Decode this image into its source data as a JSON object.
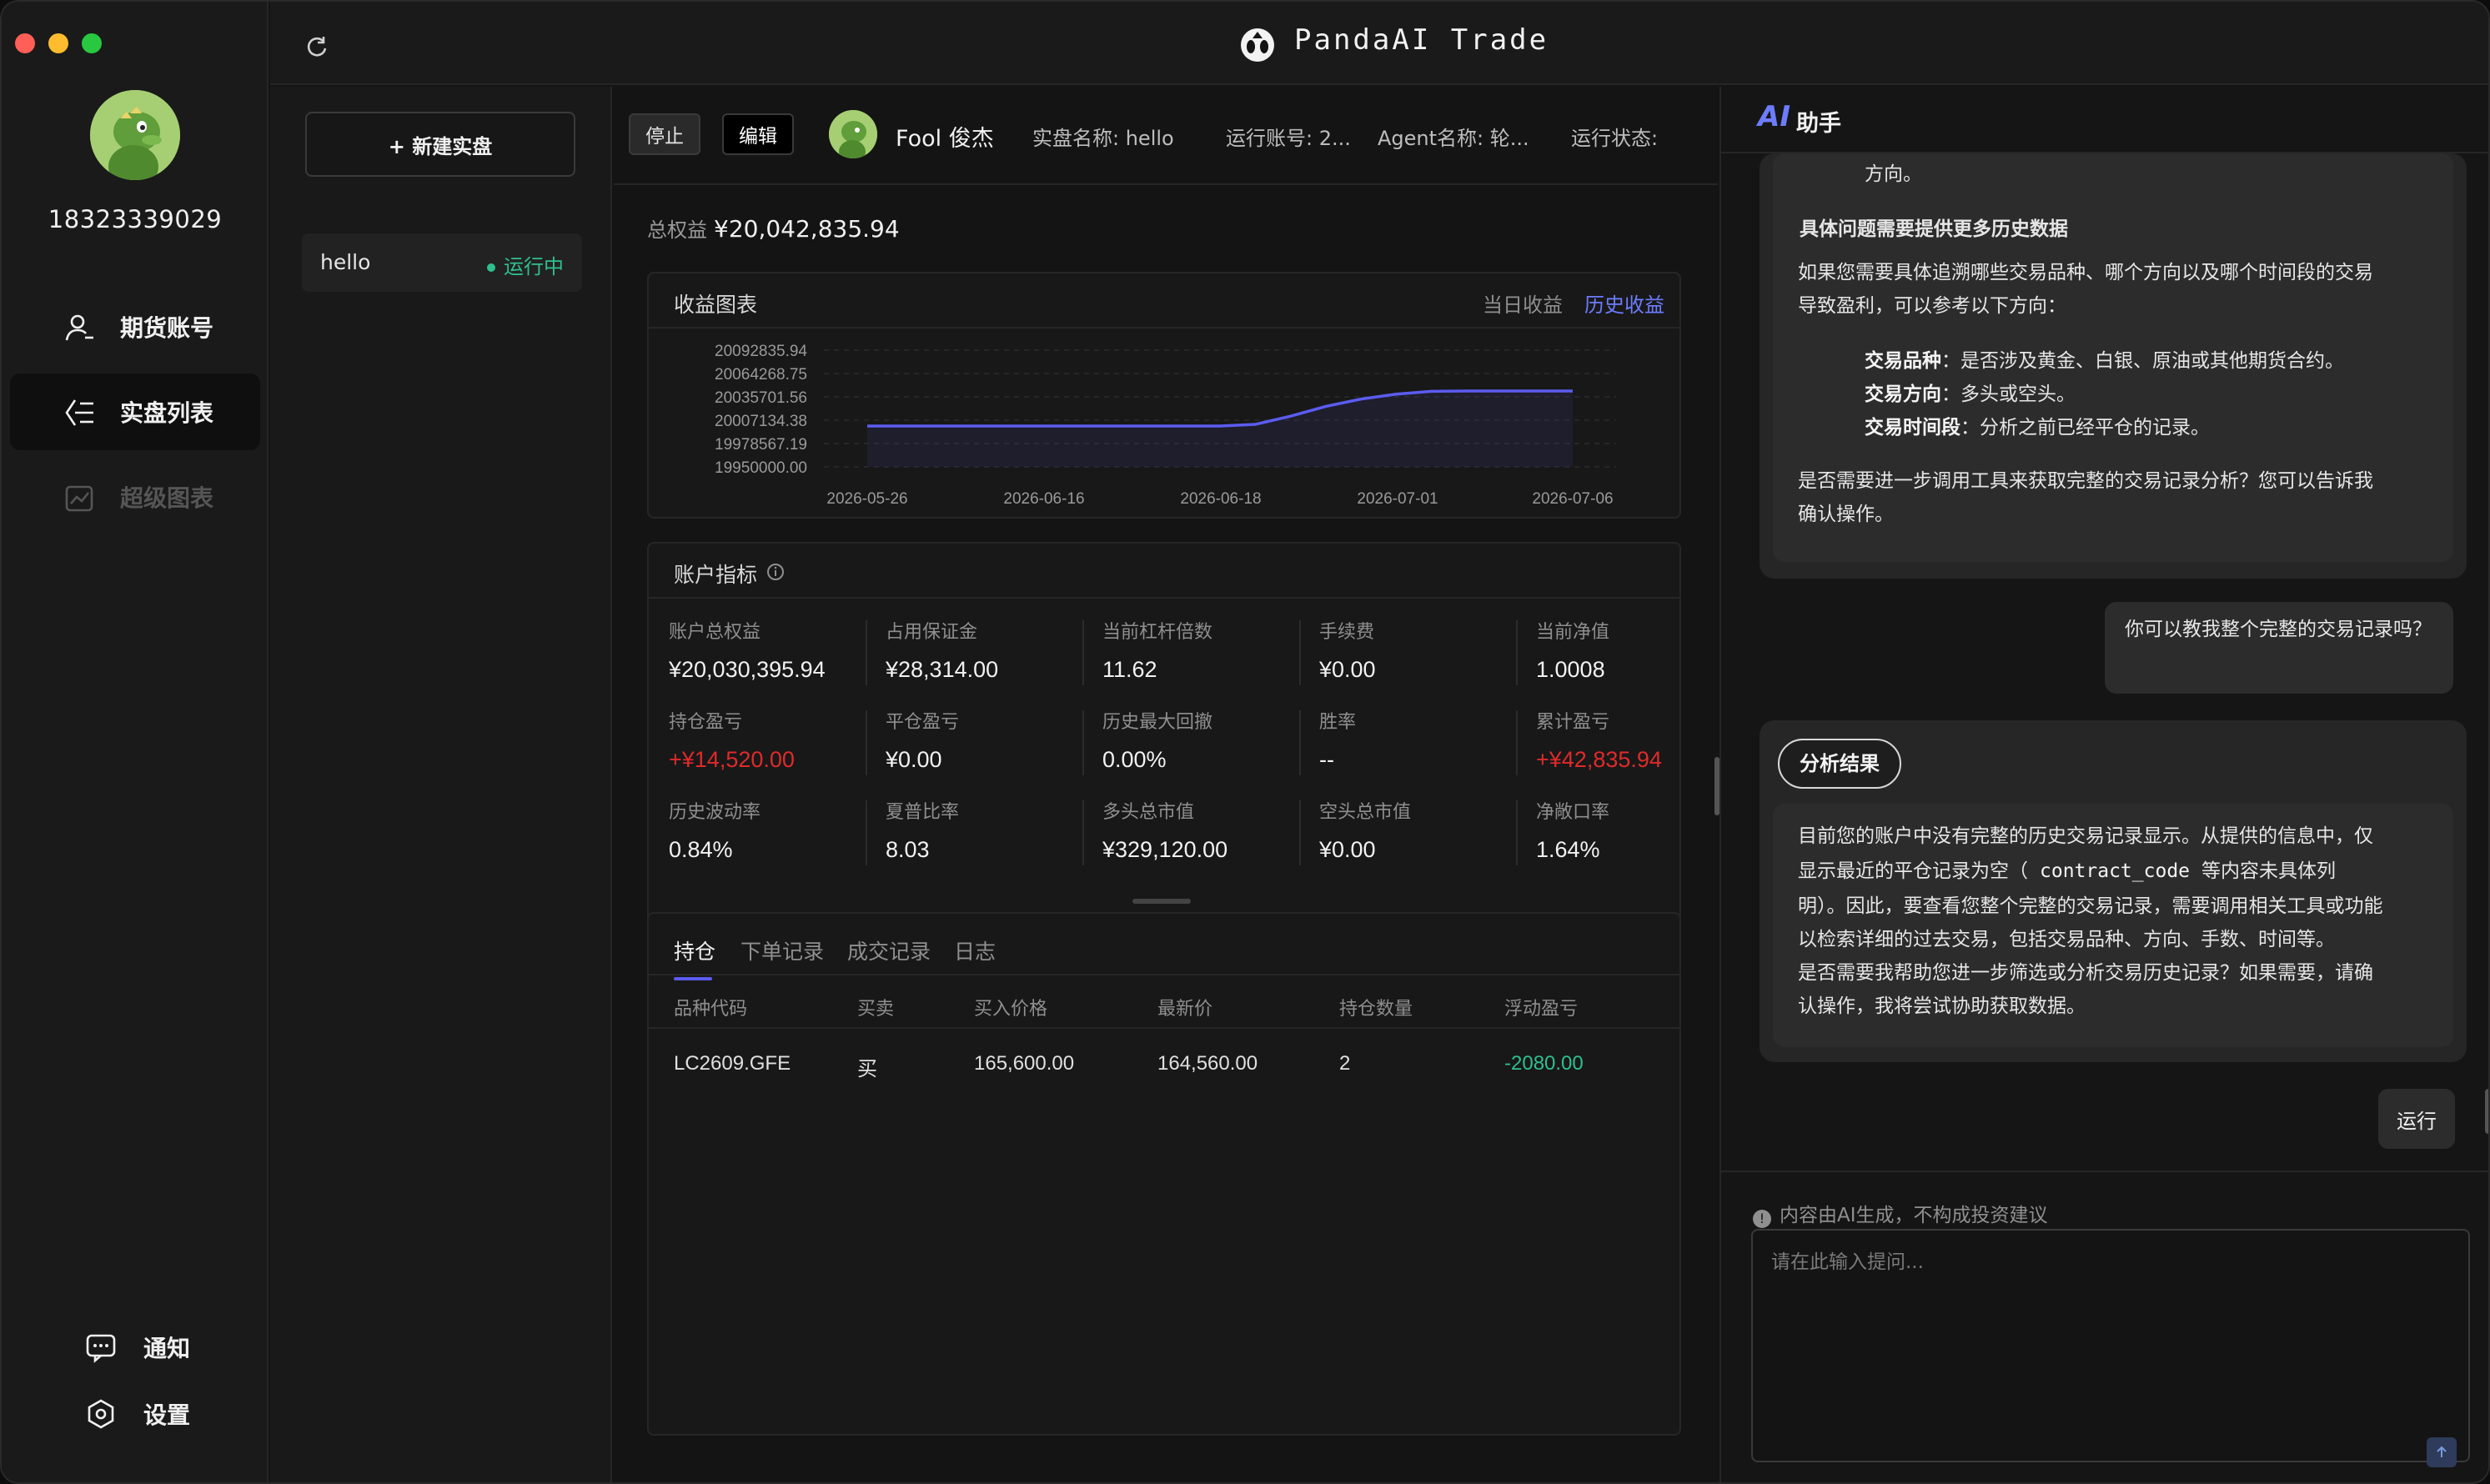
{
  "app": {
    "title": "PandaAI Trade"
  },
  "colors": {
    "accent": "#5b5cf0",
    "up": "#e02a2a",
    "down": "#2fbf8f",
    "background": "#141414"
  },
  "sidebar": {
    "phone": "18323339029",
    "items": [
      {
        "label": "期货账号",
        "icon": "user-icon"
      },
      {
        "label": "实盘列表",
        "icon": "list-icon"
      },
      {
        "label": "超级图表",
        "icon": "chart-icon"
      }
    ],
    "notify_label": "通知",
    "settings_label": "设置"
  },
  "list": {
    "new_button": "+ 新建实盘",
    "items": [
      {
        "name": "hello",
        "status": "运行中"
      }
    ]
  },
  "toolbar": {
    "stop_label": "停止",
    "edit_label": "编辑",
    "user_name": "Fool 俊杰",
    "instance_name": "实盘名称:  hello",
    "run_account": "运行账号:  2...",
    "agent_name": "Agent名称:  轮...",
    "run_status": "运行状态:"
  },
  "equity": {
    "label": "总权益",
    "value": "¥20,042,835.94"
  },
  "chart_panel": {
    "title": "收益图表",
    "tab_daily": "当日收益",
    "tab_history": "历史收益"
  },
  "chart_data": {
    "type": "area",
    "title": "收益图表",
    "x_tick_labels": [
      "2026-05-26",
      "2026-06-16",
      "2026-06-18",
      "2026-07-01",
      "2026-07-06"
    ],
    "y_tick_labels": [
      "20092835.94",
      "20064268.75",
      "20035701.56",
      "20007134.38",
      "19978567.19",
      "19950000.00"
    ],
    "ylim": [
      19950000.0,
      20092835.94
    ],
    "grid": true,
    "series": [
      {
        "values": [
          20000000,
          20000000,
          20000000,
          20000000,
          20000000,
          20000000,
          20000000,
          20000000,
          20000000,
          20000000,
          20000000,
          20002000,
          20012000,
          20024000,
          20033000,
          20039000,
          20042500,
          20042835.94,
          20042835.94,
          20042835.94,
          20042835.94
        ]
      }
    ]
  },
  "metrics": {
    "title": "账户指标",
    "items": [
      {
        "label": "账户总权益",
        "value": "¥20,030,395.94",
        "color": ""
      },
      {
        "label": "占用保证金",
        "value": "¥28,314.00",
        "color": ""
      },
      {
        "label": "当前杠杆倍数",
        "value": "11.62",
        "color": ""
      },
      {
        "label": "手续费",
        "value": "¥0.00",
        "color": ""
      },
      {
        "label": "当前净值",
        "value": "1.0008",
        "color": ""
      },
      {
        "label": "持仓盈亏",
        "value": "+¥14,520.00",
        "color": "red"
      },
      {
        "label": "平仓盈亏",
        "value": "¥0.00",
        "color": ""
      },
      {
        "label": "历史最大回撤",
        "value": "0.00%",
        "color": ""
      },
      {
        "label": "胜率",
        "value": "--",
        "color": ""
      },
      {
        "label": "累计盈亏",
        "value": "+¥42,835.94",
        "color": "red"
      },
      {
        "label": "历史波动率",
        "value": "0.84%",
        "color": ""
      },
      {
        "label": "夏普比率",
        "value": "8.03",
        "color": ""
      },
      {
        "label": "多头总市值",
        "value": "¥329,120.00",
        "color": ""
      },
      {
        "label": "空头总市值",
        "value": "¥0.00",
        "color": ""
      },
      {
        "label": "净敞口率",
        "value": "1.64%",
        "color": ""
      }
    ]
  },
  "positions": {
    "tabs": [
      "持仓",
      "下单记录",
      "成交记录",
      "日志"
    ],
    "columns": [
      "品种代码",
      "买卖",
      "买入价格",
      "最新价",
      "持仓数量",
      "浮动盈亏"
    ],
    "rows": [
      [
        "LC2609.GFE",
        "买",
        "165,600.00",
        "164,560.00",
        "2",
        "-2080.00"
      ]
    ]
  },
  "assistant": {
    "ai_label": "AI",
    "title": "助手",
    "msg1": {
      "top_line": "方向。",
      "heading": "具体问题需要提供更多历史数据",
      "para1_l1": "如果您需要具体追溯哪些交易品种、哪个方向以及哪个时间段的交易",
      "para1_l2": "导致盈利，可以参考以下方向：",
      "b1_key": "交易品种",
      "b1_val": "：是否涉及黄金、白银、原油或其他期货合约。",
      "b2_key": "交易方向",
      "b2_val": "：多头或空头。",
      "b3_key": "交易时间段",
      "b3_val": "：分析之前已经平仓的记录。",
      "para2_l1": "是否需要进一步调用工具来获取完整的交易记录分析？您可以告诉我",
      "para2_l2": "确认操作。"
    },
    "user_msg": "你可以教我整个完整的交易记录吗？",
    "result_badge": "分析结果",
    "msg2": {
      "l1": "目前您的账户中没有完整的历史交易记录显示。从提供的信息中，仅",
      "l2a": "显示最近的平仓记录为空（",
      "l2_code": "contract_code",
      "l2b": "等内容未具体列",
      "l3": "明）。因此，要查看您整个完整的交易记录，需要调用相关工具或功能",
      "l4": "以检索详细的过去交易，包括交易品种、方向、手数、时间等。",
      "l5": "是否需要我帮助您进一步筛选或分析交易历史记录？如果需要，请确",
      "l6": "认操作，我将尝试协助获取数据。"
    },
    "run_label": "运行",
    "disclaimer": "内容由AI生成，不构成投资建议",
    "input_placeholder": "请在此输入提问..."
  }
}
